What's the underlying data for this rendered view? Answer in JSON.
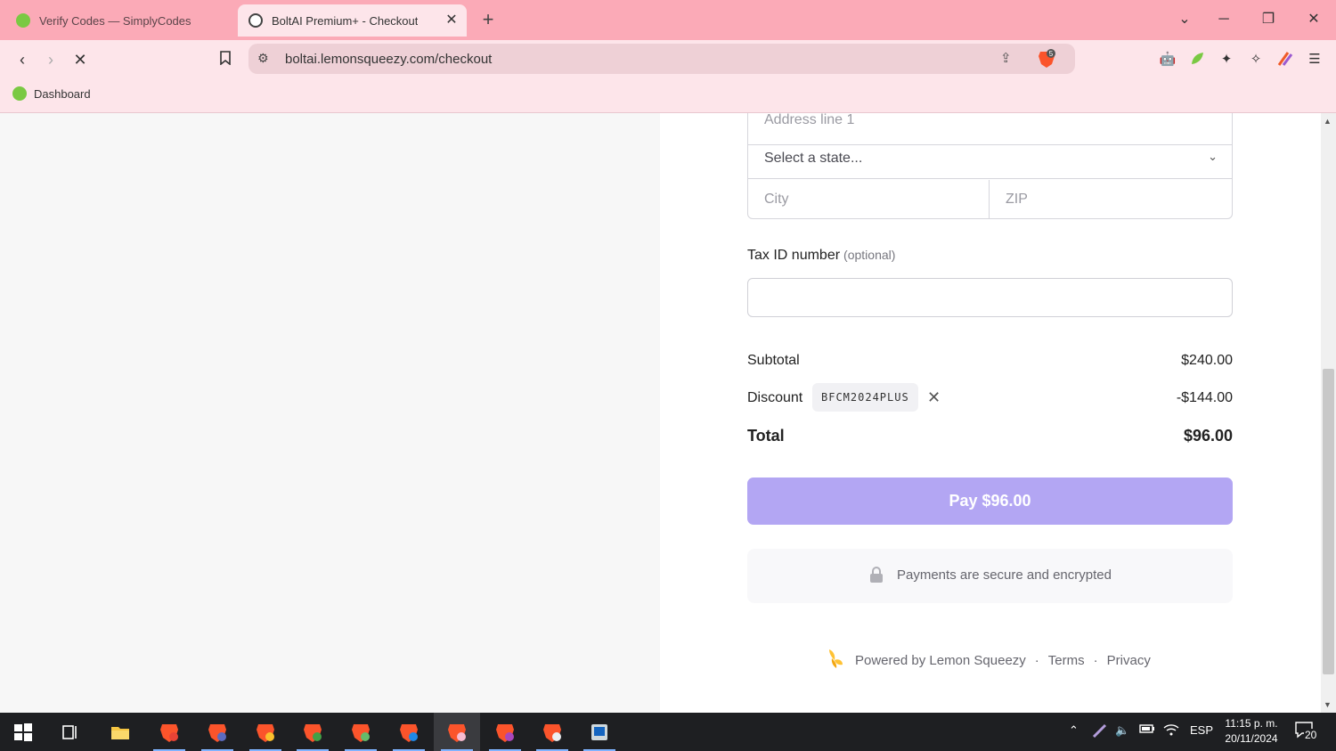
{
  "browser": {
    "tabs": [
      {
        "title": "Verify Codes — SimplyCodes",
        "active": false
      },
      {
        "title": "BoltAI Premium+ - Checkout",
        "active": true
      }
    ],
    "url": "boltai.lemonsqueezy.com/checkout",
    "brave_badge": "5",
    "bookmark": "Dashboard"
  },
  "checkout": {
    "address_line1_placeholder": "Address line 1",
    "state_placeholder": "Select a state...",
    "city_placeholder": "City",
    "zip_placeholder": "ZIP",
    "tax_label": "Tax ID number",
    "tax_optional": "(optional)",
    "subtotal_label": "Subtotal",
    "subtotal_value": "$240.00",
    "discount_label": "Discount",
    "discount_code": "BFCM2024PLUS",
    "discount_value": "-$144.00",
    "total_label": "Total",
    "total_value": "$96.00",
    "pay_button": "Pay $96.00",
    "secure_text": "Payments are secure and encrypted",
    "powered_by": "Powered by Lemon Squeezy",
    "terms": "Terms",
    "privacy": "Privacy",
    "footer_sep": "·",
    "accent_color": "#b3a6f3"
  },
  "taskbar": {
    "language": "ESP",
    "time": "11:15 p. m.",
    "date": "20/11/2024",
    "notifications": "20"
  }
}
